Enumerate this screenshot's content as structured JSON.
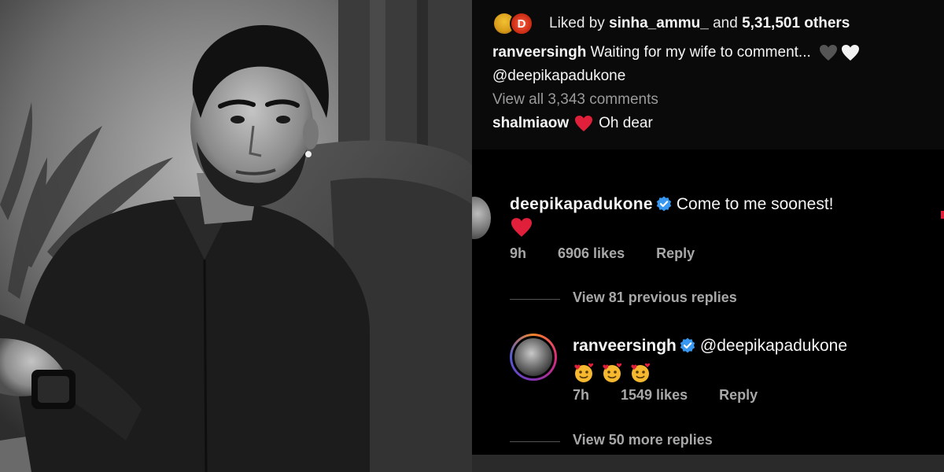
{
  "photo": {
    "alt": ""
  },
  "post": {
    "liked_prefix": "Liked by ",
    "liked_user": "sinha_ammu_",
    "liked_mid": " and ",
    "liked_count": "5,31,501 others",
    "caption_user": "ranveersingh",
    "caption_text": " Waiting for my wife to comment...",
    "caption_mention": "@deepikapadukone",
    "view_all": "View all 3,343 comments",
    "first_comment_user": "shalmiaow",
    "first_comment_text": "Oh dear"
  },
  "comment": {
    "user": "deepikapadukone",
    "text": "Come to me soonest!",
    "time": "9h",
    "likes": "6906 likes",
    "reply_label": "Reply",
    "view_previous": "View 81 previous replies"
  },
  "reply": {
    "user": "ranveersingh",
    "mention": "@deepikapadukone",
    "time": "7h",
    "likes": "1549 likes",
    "reply_label": "Reply",
    "view_more": "View 50 more replies"
  },
  "colors": {
    "background": "#000000",
    "verified": "#3897f0",
    "heart_red": "#e0203a",
    "muted": "#a8a8a8"
  },
  "icons": [
    "verified-badge-icon",
    "red-heart-icon",
    "black-heart-icon",
    "white-heart-icon",
    "smiling-face-with-hearts-icon"
  ]
}
